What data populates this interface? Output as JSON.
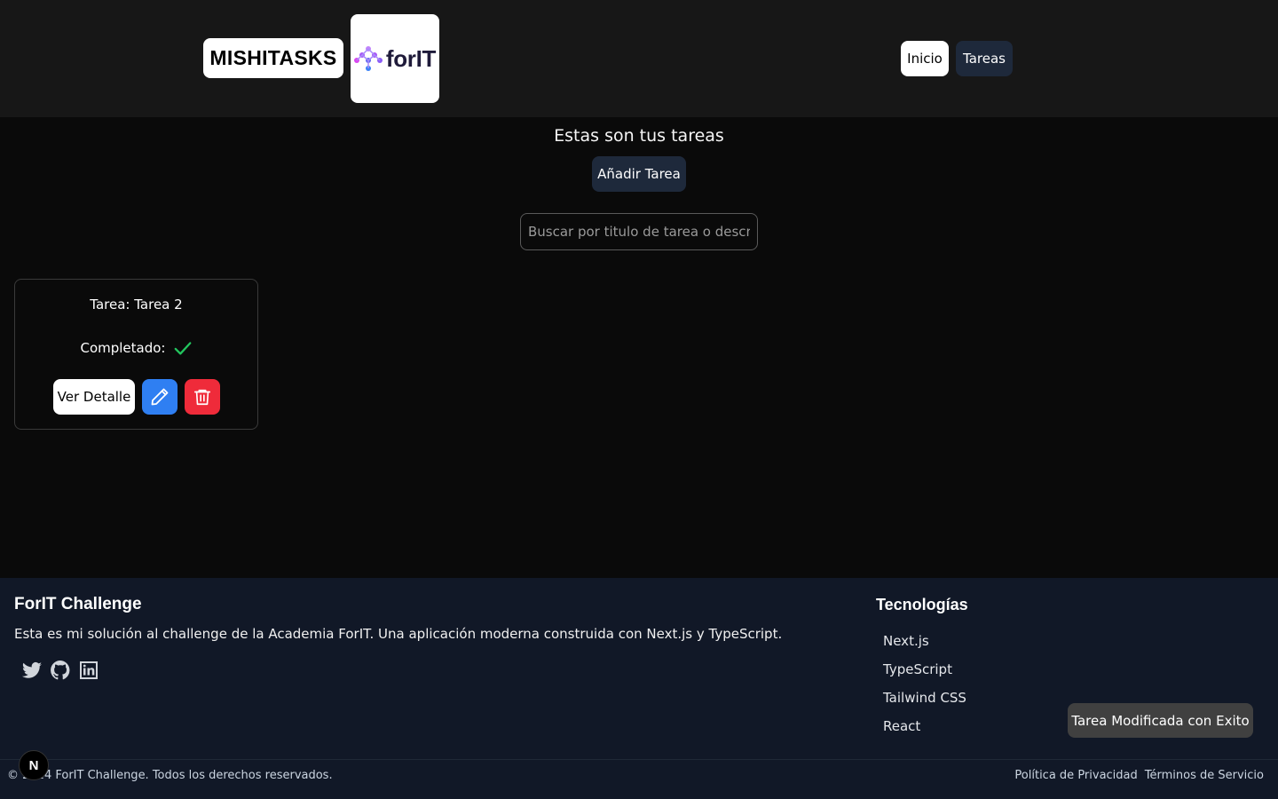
{
  "header": {
    "brand": "MISHITASKS",
    "logo_text": "forIT",
    "nav": [
      {
        "label": "Inicio"
      },
      {
        "label": "Tareas"
      }
    ]
  },
  "main": {
    "title": "Estas son tus tareas",
    "add_button": "Añadir Tarea",
    "search_placeholder": "Buscar por titulo de tarea o descripcion",
    "tasks": [
      {
        "title": "Tarea: Tarea 2",
        "status_label": "Completado:",
        "completed": true,
        "detail_button": "Ver Detalle",
        "edit_icon": "pencil-icon",
        "delete_icon": "trash-icon"
      }
    ]
  },
  "footer": {
    "title": "ForIT Challenge",
    "description": "Esta es mi solución al challenge de la Academia ForIT. Una aplicación moderna construida con Next.js y TypeScript.",
    "socials": [
      "twitter-icon",
      "github-icon",
      "linkedin-icon"
    ],
    "tech_title": "Tecnologías",
    "technologies": [
      "Next.js",
      "TypeScript",
      "Tailwind CSS",
      "React"
    ],
    "copyright": "© 2024 ForIT Challenge. Todos los derechos reservados.",
    "links": [
      "Política de Privacidad",
      "Términos de Servicio"
    ]
  },
  "toast": {
    "message": "Tarea Modificada con Exito"
  },
  "dev_badge": {
    "label": "N"
  },
  "colors": {
    "edit": "#2f7ff2",
    "delete": "#ef2b3a",
    "check": "#22c55e",
    "footer_bg": "#111827"
  }
}
